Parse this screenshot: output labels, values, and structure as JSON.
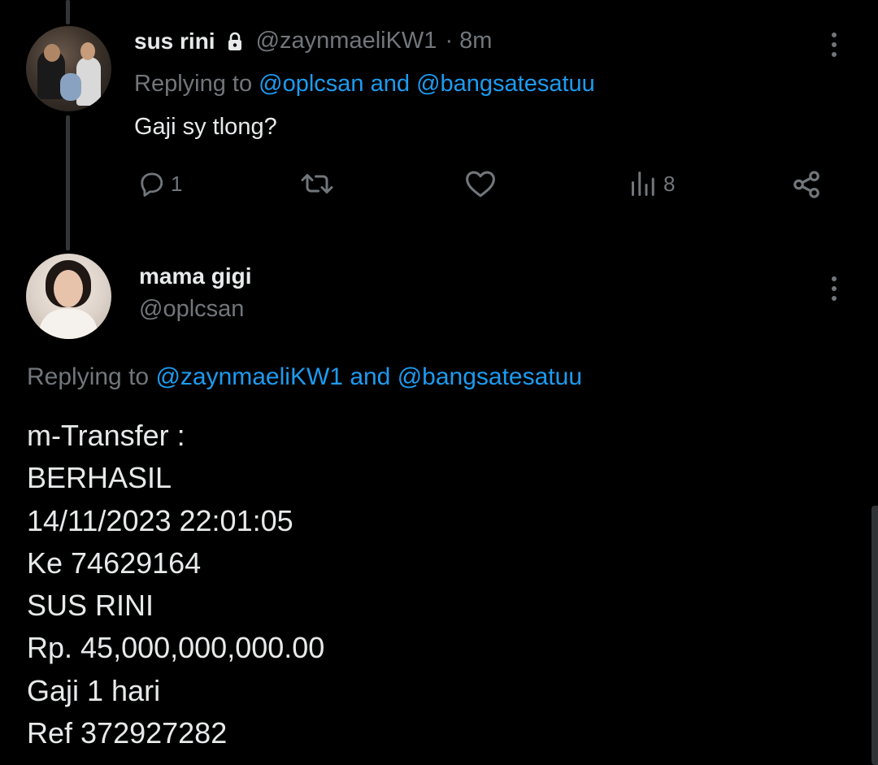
{
  "post1": {
    "display_name": "sus rini",
    "handle": "@zaynmaeliKW1",
    "time": "· 8m",
    "replying_prefix": "Replying to",
    "replying_user1": "@oplcsan",
    "replying_and": "and",
    "replying_user2": "@bangsatesatuu",
    "text": "Gaji sy tlong?",
    "actions": {
      "reply_count": "1",
      "retweet_count": "",
      "like_count": "",
      "views_count": "8"
    },
    "locked": true
  },
  "post2": {
    "display_name": "mama gigi",
    "handle": "@oplcsan",
    "replying_prefix": "Replying to",
    "replying_user1": "@zaynmaeliKW1",
    "replying_and": "and",
    "replying_user2": "@bangsatesatuu",
    "text_lines": [
      "m-Transfer :",
      "BERHASIL",
      "14/11/2023 22:01:05",
      "Ke 74629164",
      "SUS RINI",
      "Rp. 45,000,000,000.00",
      "Gaji 1 hari",
      "Ref 372927282"
    ]
  },
  "colors": {
    "background": "#000000",
    "text_primary": "#e7e9ea",
    "text_secondary": "#71767b",
    "link": "#1d9bf0"
  },
  "icons": [
    "lock-icon",
    "reply-icon",
    "retweet-icon",
    "like-icon",
    "views-icon",
    "share-icon",
    "more-icon"
  ]
}
